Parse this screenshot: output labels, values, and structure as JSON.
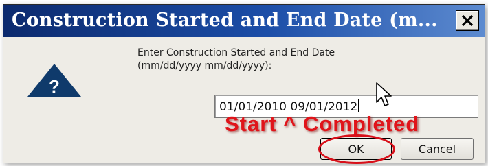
{
  "dialog": {
    "title": "Construction Started and End Date (m...",
    "prompt_line1": "Enter Construction Started and End Date",
    "prompt_line2": "(mm/dd/yyyy mm/dd/yyyy):",
    "input_value": "01/01/2010 09/01/2012",
    "ok_label": "OK",
    "cancel_label": "Cancel",
    "icon": "question-warning-icon",
    "close_icon": "close-icon"
  },
  "annotation": {
    "text": "Start ^ Completed",
    "color": "#e0141a"
  },
  "colors": {
    "titlebar": "#0c2a6e",
    "dialog_bg": "#eeece6",
    "icon_fill": "#0f3a6b"
  }
}
